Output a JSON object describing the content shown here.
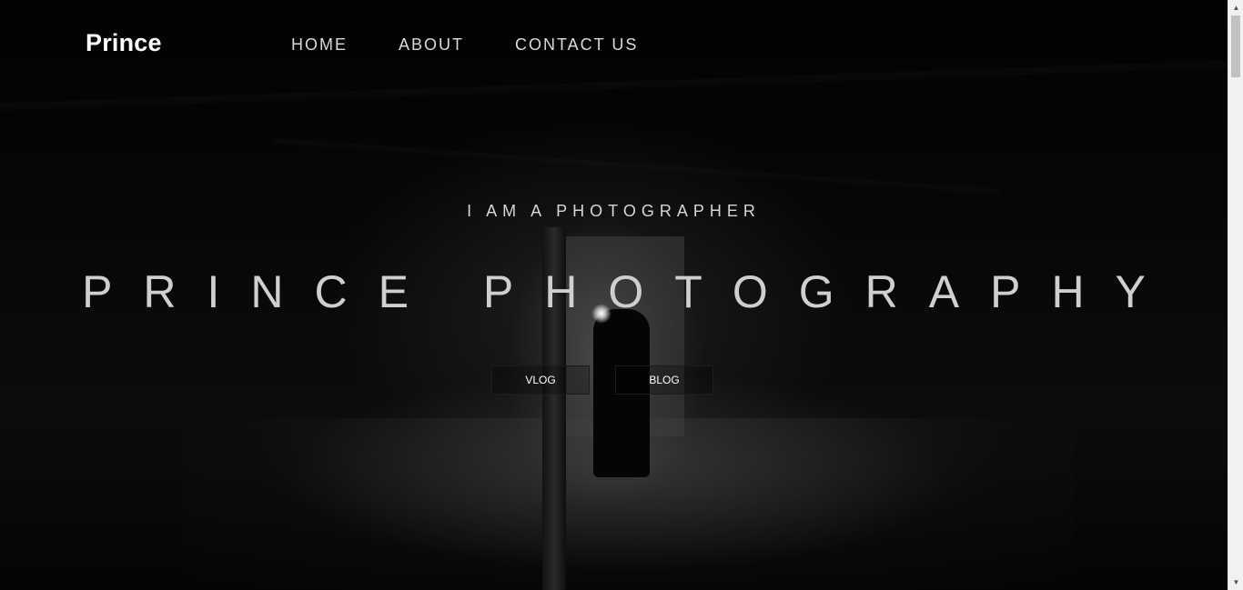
{
  "header": {
    "logo": "Prince",
    "nav": [
      {
        "label": "HOME"
      },
      {
        "label": "ABOUT"
      },
      {
        "label": "CONTACT US"
      }
    ]
  },
  "hero": {
    "tagline": "I AM A PHOTOGRAPHER",
    "title": "PRINCE PHOTOGRAPHY",
    "buttons": [
      {
        "label": "VLOG"
      },
      {
        "label": "BLOG"
      }
    ],
    "background_image": "dark attic photographer silhouette with camera flash"
  },
  "scrollbar": {
    "up_icon": "chevron-up-icon",
    "down_icon": "chevron-down-icon"
  },
  "colors": {
    "background": "#000000",
    "text": "#d9d9d9",
    "logo": "#ffffff"
  }
}
